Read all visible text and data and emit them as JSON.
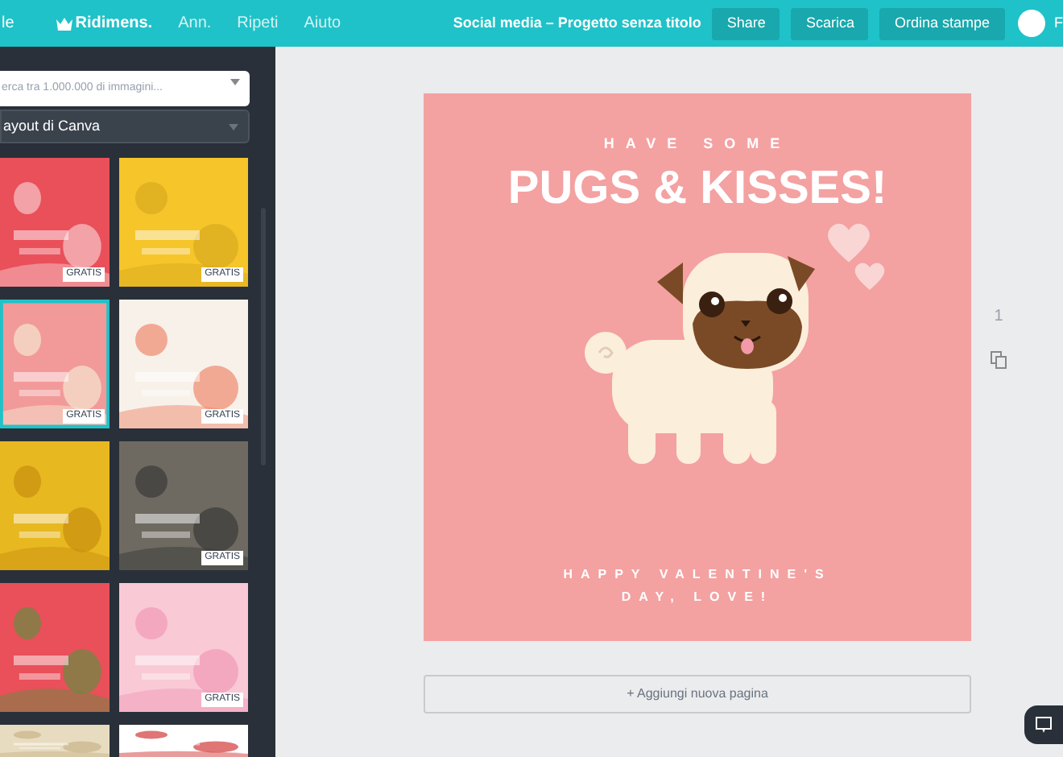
{
  "top_bar": {
    "left_cut": "le",
    "menu": [
      {
        "label": "Ridimens.",
        "kind": "crown"
      },
      {
        "label": "Ann.",
        "kind": "plain"
      },
      {
        "label": "Ripeti",
        "kind": "plain"
      },
      {
        "label": "Aiuto",
        "kind": "plain"
      }
    ],
    "title": "Social media – Progetto senza titolo",
    "buttons": [
      "Share",
      "Scarica",
      "Ordina stampe"
    ],
    "user_cut": "F"
  },
  "sidebar": {
    "search": {
      "placeholder": "erca tra 1.000.000 di immagini..."
    },
    "layout_select": "ayout di Canva",
    "templates": [
      {
        "kind": "picture",
        "badge": "GRATIS",
        "selected": false
      },
      {
        "kind": "picture",
        "badge": "GRATIS",
        "selected": false
      },
      {
        "kind": "picture",
        "badge": "GRATIS",
        "selected": true
      },
      {
        "kind": "picture",
        "badge": "GRATIS",
        "selected": false
      },
      {
        "kind": "picture",
        "selected": false
      },
      {
        "kind": "picture",
        "badge": "GRATIS",
        "selected": false
      },
      {
        "kind": "picture",
        "selected": false
      },
      {
        "kind": "picture",
        "badge": "GRATIS",
        "selected": false
      },
      {
        "kind": "picture",
        "selected": false
      },
      {
        "kind": "picture",
        "selected": false
      }
    ]
  },
  "design": {
    "kicker": "HAVE SOME",
    "headline": "PUGS & KISSES!",
    "footer": [
      "HAPPY VALENTINE'S",
      "DAY, LOVE!"
    ]
  },
  "page_tools": {
    "page_number": "1"
  },
  "add_page_button": "+ Aggiungi nuova pagina"
}
